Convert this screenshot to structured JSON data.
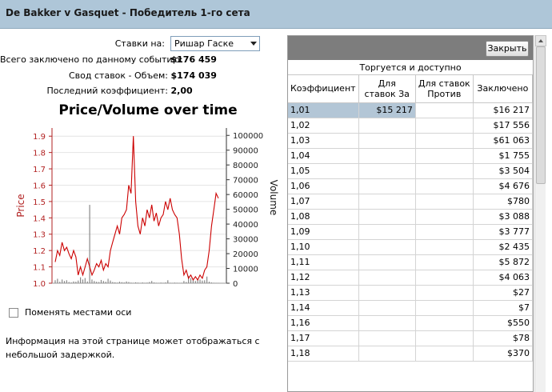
{
  "title": "De Bakker v Gasquet - Победитель 1-го сета",
  "form": {
    "bets_on_label": "Ставки на:",
    "bets_on_value": "Ришар Гаске",
    "total_label": "Всего заключено по данному событию:",
    "total_value": "$176 459",
    "volume_label": "Свод ставок - Объем:",
    "volume_value": "$174 039",
    "last_odds_label": "Последний коэффициент:",
    "last_odds_value": "2,00"
  },
  "swap_axes_label": "Поменять местами оси",
  "info_text": "Информация на этой странице может отображаться с небольшой задержкой.",
  "panel": {
    "close_label": "Закрыть",
    "group_header": "Торгуется и доступно",
    "columns": [
      "Коэффициент",
      "Для ставок За",
      "Для ставок Против",
      "Заключено"
    ],
    "rows": [
      {
        "odds": "1,01",
        "back": "$15 217",
        "lay": "",
        "matched": "$16 217",
        "selected": true
      },
      {
        "odds": "1,02",
        "back": "",
        "lay": "",
        "matched": "$17 556"
      },
      {
        "odds": "1,03",
        "back": "",
        "lay": "",
        "matched": "$61 063"
      },
      {
        "odds": "1,04",
        "back": "",
        "lay": "",
        "matched": "$1 755"
      },
      {
        "odds": "1,05",
        "back": "",
        "lay": "",
        "matched": "$3 504"
      },
      {
        "odds": "1,06",
        "back": "",
        "lay": "",
        "matched": "$4 676"
      },
      {
        "odds": "1,07",
        "back": "",
        "lay": "",
        "matched": "$780"
      },
      {
        "odds": "1,08",
        "back": "",
        "lay": "",
        "matched": "$3 088"
      },
      {
        "odds": "1,09",
        "back": "",
        "lay": "",
        "matched": "$3 777"
      },
      {
        "odds": "1,10",
        "back": "",
        "lay": "",
        "matched": "$2 435"
      },
      {
        "odds": "1,11",
        "back": "",
        "lay": "",
        "matched": "$5 872"
      },
      {
        "odds": "1,12",
        "back": "",
        "lay": "",
        "matched": "$4 063"
      },
      {
        "odds": "1,13",
        "back": "",
        "lay": "",
        "matched": "$27"
      },
      {
        "odds": "1,14",
        "back": "",
        "lay": "",
        "matched": "$7"
      },
      {
        "odds": "1,16",
        "back": "",
        "lay": "",
        "matched": "$550"
      },
      {
        "odds": "1,17",
        "back": "",
        "lay": "",
        "matched": "$78"
      },
      {
        "odds": "1,18",
        "back": "",
        "lay": "",
        "matched": "$370"
      }
    ]
  },
  "chart_data": {
    "type": "line",
    "title": "Price/Volume over time",
    "ylabel": "Price",
    "y2label": "Volume",
    "ylim": [
      1.0,
      1.95
    ],
    "y2lim": [
      0,
      105000
    ],
    "yticks": [
      "1.0",
      "1.1",
      "1.2",
      "1.3",
      "1.4",
      "1.5",
      "1.6",
      "1.7",
      "1.8",
      "1.9"
    ],
    "y2ticks": [
      "0",
      "10000",
      "20000",
      "30000",
      "40000",
      "50000",
      "60000",
      "70000",
      "80000",
      "90000",
      "100000"
    ],
    "grid": true,
    "colors": {
      "price": "#cc0000",
      "volume": "#888888",
      "price_axis": "#b22222"
    },
    "price": [
      1.13,
      1.2,
      1.17,
      1.25,
      1.2,
      1.22,
      1.18,
      1.15,
      1.2,
      1.16,
      1.05,
      1.1,
      1.05,
      1.1,
      1.15,
      1.1,
      1.05,
      1.08,
      1.12,
      1.1,
      1.14,
      1.08,
      1.12,
      1.1,
      1.2,
      1.25,
      1.3,
      1.35,
      1.3,
      1.4,
      1.42,
      1.45,
      1.6,
      1.55,
      1.9,
      1.5,
      1.35,
      1.3,
      1.4,
      1.35,
      1.45,
      1.4,
      1.48,
      1.38,
      1.43,
      1.35,
      1.4,
      1.42,
      1.5,
      1.45,
      1.52,
      1.45,
      1.42,
      1.4,
      1.3,
      1.15,
      1.05,
      1.08,
      1.03,
      1.05,
      1.02,
      1.04,
      1.02,
      1.05,
      1.03,
      1.08,
      1.1,
      1.2,
      1.35,
      1.45,
      1.55,
      1.52
    ],
    "volume": [
      2000,
      3000,
      1000,
      2500,
      1500,
      2000,
      800,
      500,
      1200,
      1000,
      1800,
      4000,
      2500,
      3500,
      1200,
      53000,
      2500,
      1500,
      1000,
      800,
      2200,
      1500,
      1000,
      3000,
      1800,
      800,
      600,
      400,
      1000,
      700,
      500,
      1200,
      800,
      400,
      300,
      600,
      400,
      200,
      500,
      300,
      400,
      800,
      1500,
      500,
      300,
      200,
      400,
      300,
      500,
      2000,
      300,
      200,
      400,
      300,
      200,
      300,
      1500,
      800,
      5000,
      3500,
      2000,
      1500,
      3000,
      2500,
      1800,
      2000,
      4500,
      1000,
      500,
      300,
      200,
      100
    ]
  }
}
